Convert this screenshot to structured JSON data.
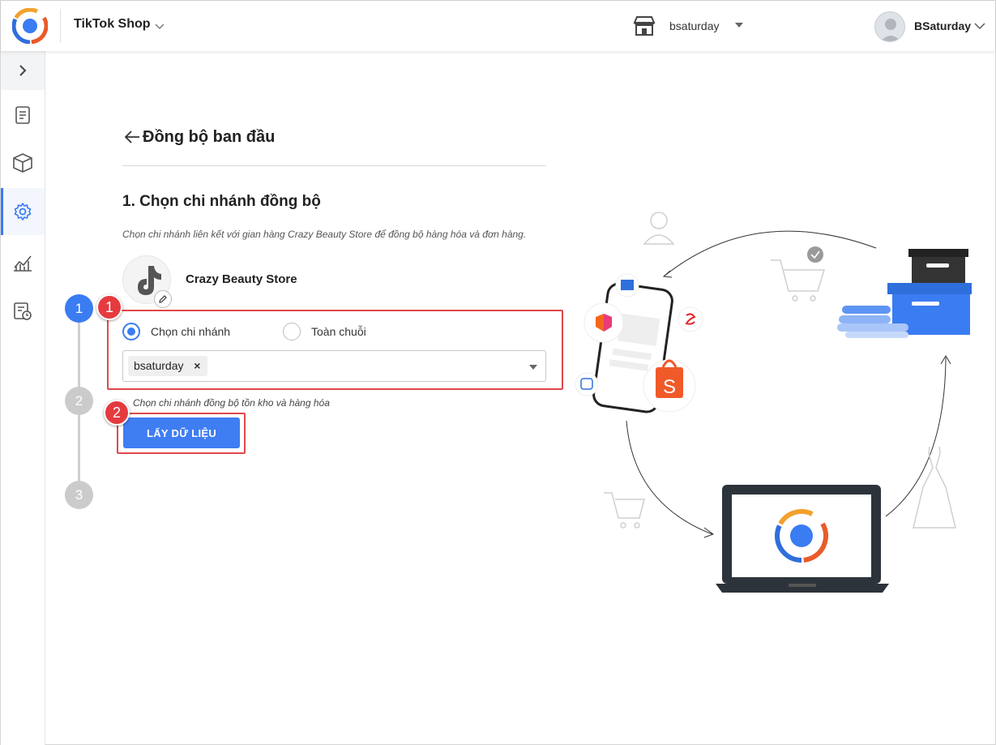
{
  "header": {
    "channel_name": "TikTok Shop",
    "branch_name": "bsaturday",
    "user_name": "BSaturday"
  },
  "sidebar": {
    "items": [
      {
        "icon": "orders-icon"
      },
      {
        "icon": "box-icon"
      },
      {
        "icon": "settings-icon",
        "active": true
      },
      {
        "icon": "report-icon"
      },
      {
        "icon": "history-icon"
      }
    ]
  },
  "page": {
    "title": "Đồng bộ ban đầu",
    "section_title": "1. Chọn chi nhánh đồng bộ",
    "section_desc": "Chọn chi nhánh liên kết với gian hàng Crazy Beauty Store để đồng bộ hàng hóa và đơn hàng.",
    "shop_name": "Crazy Beauty Store",
    "radio_options": [
      {
        "label": "Chọn chi nhánh",
        "checked": true
      },
      {
        "label": "Toàn chuỗi",
        "checked": false
      }
    ],
    "selected_branch_tag": "bsaturday",
    "tag_remove": "×",
    "hint": "Chọn chi nhánh đồng bộ tồn kho và hàng hóa",
    "fetch_button_label": "LẤY DỮ LIỆU"
  },
  "steps": [
    "1",
    "2",
    "3"
  ],
  "annotations": [
    "1",
    "2"
  ],
  "colors": {
    "accent": "#3a7cf2",
    "highlight": "#e0484b",
    "step_inactive": "#cbcbcb"
  }
}
